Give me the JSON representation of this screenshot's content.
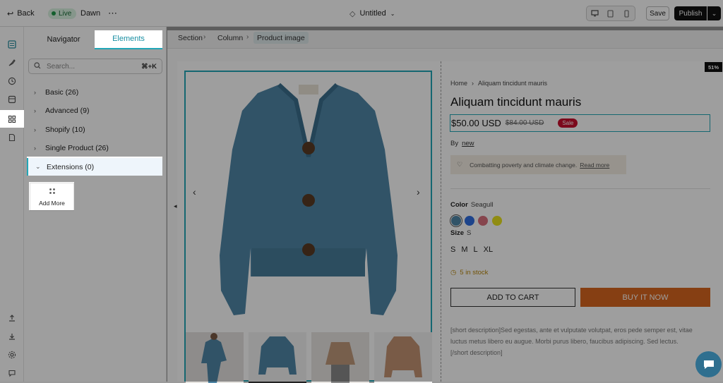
{
  "topbar": {
    "back_label": "Back",
    "live_label": "Live",
    "theme_label": "Dawn",
    "more_label": "⋯",
    "page_title": "Untitled",
    "save_label": "Save",
    "publish_label": "Publish"
  },
  "panel": {
    "tabs": [
      {
        "label": "Navigator",
        "active": false
      },
      {
        "label": "Elements",
        "active": true
      }
    ],
    "search": {
      "placeholder": "Search...",
      "shortcut": "⌘+K"
    },
    "categories": [
      {
        "label": "Basic (26)",
        "expanded": false
      },
      {
        "label": "Advanced (9)",
        "expanded": false
      },
      {
        "label": "Shopify (10)",
        "expanded": false
      },
      {
        "label": "Single Product (26)",
        "expanded": false
      },
      {
        "label": "Extensions (0)",
        "expanded": true
      }
    ],
    "add_more_label": "Add More"
  },
  "canvas": {
    "breadcrumb": [
      "Section",
      "Column",
      "Product image"
    ],
    "zoom_badge": "51%"
  },
  "product": {
    "breadcrumb_home": "Home",
    "breadcrumb_current": "Aliquam tincidunt mauris",
    "title": "Aliquam tincidunt mauris",
    "price": "$50.00 USD",
    "compare_price": "$84.00 USD",
    "sale_badge": "Sale",
    "vendor_prefix": "By",
    "vendor": "new",
    "notice_text": "Combatting poverty and climate change.",
    "notice_link": "Read more",
    "color_label": "Color",
    "color_value": "Seagull",
    "swatches": [
      "#4f86a6",
      "#2f6fe0",
      "#d9707d",
      "#e9e21d"
    ],
    "size_label": "Size",
    "size_value": "S",
    "sizes": [
      "S",
      "M",
      "L",
      "XL"
    ],
    "stock_text": "5 in stock",
    "add_to_cart_label": "ADD TO CART",
    "buy_now_label": "BUY IT NOW",
    "description": "[short description]Sed egestas, ante et vulputate volutpat, eros pede semper est, vitae luctus metus libero eu augue. Morbi purus libero, faucibus adipiscing. Sed lectus.",
    "description_end": "[/short description]"
  },
  "colors": {
    "accent": "#23a7b7",
    "buy_button": "#d9661f",
    "sale_badge": "#c8102e",
    "chat_bubble": "#2f6f8f"
  }
}
